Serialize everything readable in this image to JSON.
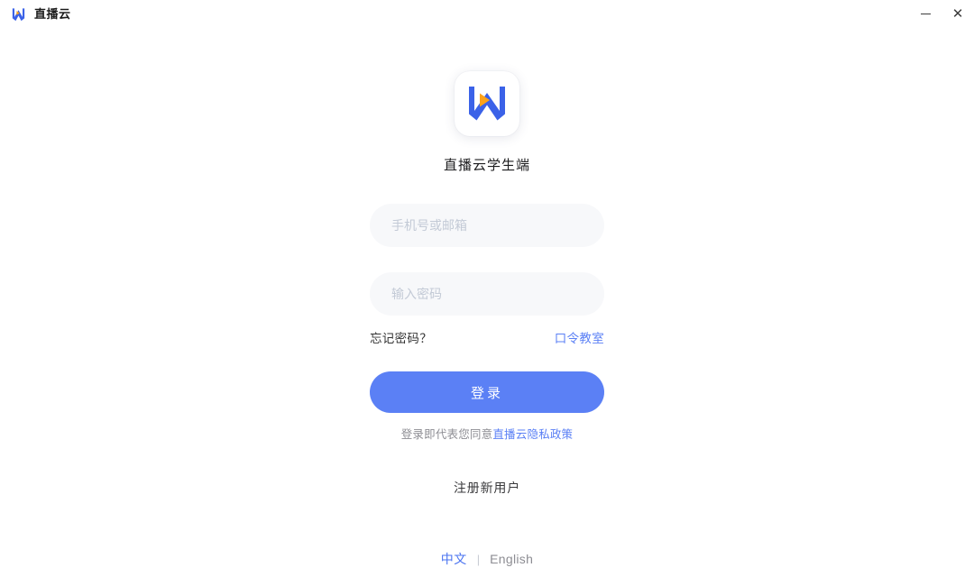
{
  "titlebar": {
    "brand_name": "直播云",
    "logo_icon": "w-logo-icon",
    "minimize_label": "",
    "close_label": "✕",
    "colors": {
      "logo_blue": "#3b62e8",
      "logo_orange": "#ffa319"
    }
  },
  "login": {
    "app_icon": "app-logo-icon",
    "app_title": "直播云学生端",
    "account": {
      "placeholder": "手机号或邮箱",
      "value": ""
    },
    "password": {
      "placeholder": "输入密码",
      "value": ""
    },
    "forgot_password_label": "忘记密码？",
    "passcode_classroom_label": "口令教室",
    "login_button_label": "登录",
    "agreement_prefix": "登录即代表您同意",
    "agreement_link": "直播云隐私政策",
    "register_label": "注册新用户",
    "language": {
      "active": "中文",
      "separator": "|",
      "inactive": "English"
    },
    "colors": {
      "accent": "#5b80f5",
      "link": "#4a73f0",
      "field_bg": "#f7f8fa",
      "placeholder": "#c3cad6"
    }
  }
}
